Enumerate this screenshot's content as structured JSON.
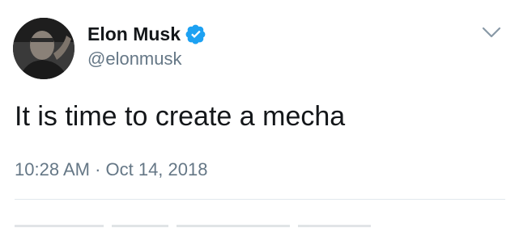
{
  "tweet": {
    "display_name": "Elon Musk",
    "handle": "@elonmusk",
    "text": "It is time to create a mecha",
    "timestamp": "10:28 AM · Oct 14, 2018",
    "verified": true
  },
  "icons": {
    "verified": "verified-badge-icon",
    "menu": "chevron-down-icon",
    "avatar": "profile-photo"
  },
  "colors": {
    "text_primary": "#14171a",
    "text_secondary": "#657786",
    "verified_blue": "#1da1f2",
    "divider": "#e1e8ed"
  }
}
